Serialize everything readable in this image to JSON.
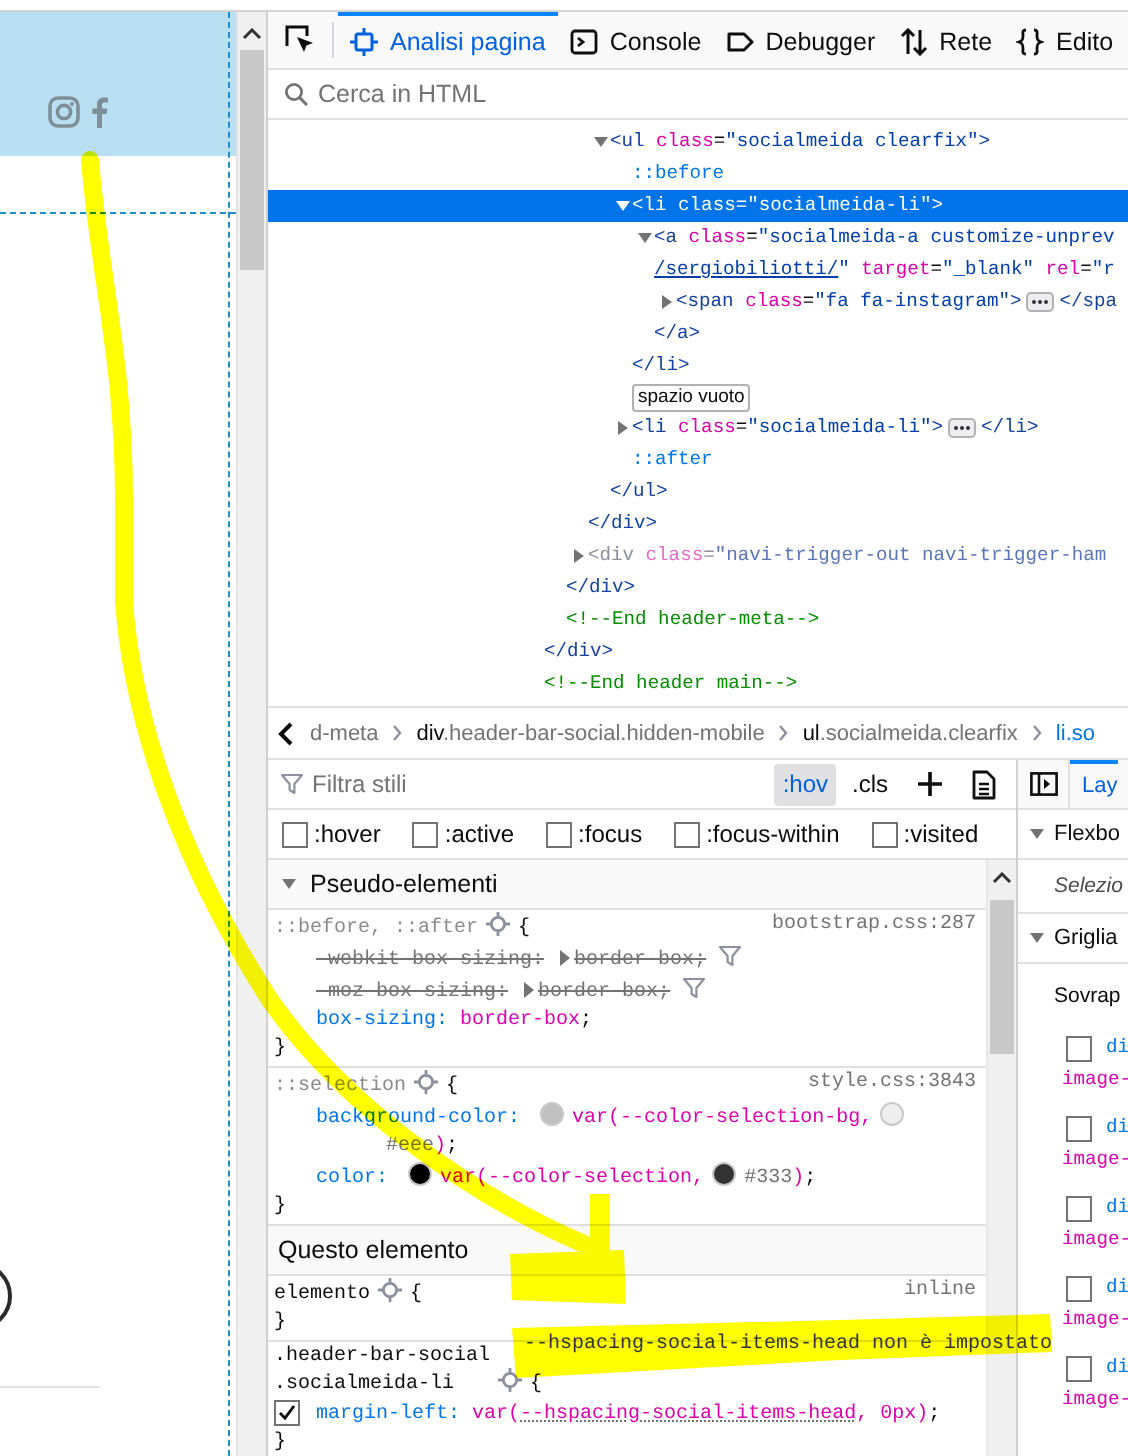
{
  "toolbar": {
    "tabs": [
      {
        "label": "Analisi pagina",
        "kind": "inspector",
        "selected": true
      },
      {
        "label": "Console",
        "kind": "console",
        "selected": false
      },
      {
        "label": "Debugger",
        "kind": "debugger",
        "selected": false
      },
      {
        "label": "Rete",
        "kind": "network",
        "selected": false
      },
      {
        "label": "Edito",
        "kind": "editor",
        "selected": false
      }
    ]
  },
  "html_search": {
    "placeholder": "Cerca in HTML"
  },
  "markup_tree": [
    {
      "children": [
        {
          "children": [
            {
              "children": [
                {
                  "kind": "tag",
                  "text": "<ul class=\"socialmeida clearfix\">",
                  "expanded": true,
                  "selected": false,
                  "children": [
                    {
                      "kind": "pseudo",
                      "text": "::before",
                      "selected": false
                    },
                    {
                      "kind": "tag",
                      "text": "<li class=\"socialmeida-li\">",
                      "expanded": true,
                      "selected": true,
                      "children": [
                        {
                          "kind": "tag",
                          "text": "<a class=\"socialmeida-a customize-unprev",
                          "wrap_link": "/sergiobiliotti/",
                          "wrap": "\" target=\"_blank\" rel=\"r",
                          "expanded": true,
                          "selected": false,
                          "children": [
                            {
                              "kind": "tag",
                              "text": "<span class=\"fa fa-instagram\">",
                              "end": "</spa",
                              "expanded": false,
                              "selected": false
                            }
                          ]
                        },
                        {
                          "kind": "tag",
                          "text": "</a>",
                          "selected": false
                        }
                      ]
                    },
                    {
                      "kind": "tag",
                      "text": "</li>",
                      "selected": false
                    },
                    {
                      "kind": "whitespace",
                      "text": "spazio vuoto",
                      "selected": false
                    },
                    {
                      "kind": "tag",
                      "text": "<li class=\"socialmeida-li\">",
                      "end": "</li>",
                      "expanded": false,
                      "selected": false
                    },
                    {
                      "kind": "pseudo",
                      "text": "::after",
                      "selected": false
                    }
                  ]
                },
                {
                  "kind": "tag",
                  "text": "</ul>",
                  "selected": false
                }
              ]
            },
            {
              "kind": "tag",
              "text": "</div>",
              "selected": false
            },
            {
              "kind": "tag",
              "text": "<div class=\"navi-trigger-out navi-trigger-ham",
              "expanded": false,
              "hidden_element": true,
              "selected": false
            }
          ]
        },
        {
          "kind": "tag",
          "text": "</div>",
          "selected": false
        },
        {
          "kind": "comment",
          "text": "<!--End header-meta-->",
          "selected": false
        }
      ]
    },
    {
      "kind": "tag",
      "text": "</div>",
      "selected": false
    },
    {
      "kind": "comment",
      "text": "<!--End header main-->",
      "selected": false
    }
  ],
  "breadcrumbs": [
    {
      "text": "d-meta",
      "selected": false
    },
    {
      "text": "div.header-bar-social.hidden-mobile",
      "selected": false
    },
    {
      "text": "ul.socialmeida.clearfix",
      "selected": false
    },
    {
      "text": "li.so",
      "selected": true
    }
  ],
  "rules_toolbar": {
    "filter_placeholder": "Filtra stili",
    "toggles": [
      {
        "label": ":hov",
        "pressed": true
      },
      {
        "label": ".cls",
        "pressed": false
      }
    ]
  },
  "pseudo_classes": [
    {
      "label": ":hover",
      "checked": false
    },
    {
      "label": ":active",
      "checked": false
    },
    {
      "label": ":focus",
      "checked": false
    },
    {
      "label": ":focus-within",
      "checked": false
    },
    {
      "label": ":visited",
      "checked": false
    }
  ],
  "styles": [
    {
      "kind": "section",
      "title": "Pseudo-elementi",
      "expanded": true
    },
    {
      "kind": "rule",
      "selector": [
        "::before, ::after"
      ],
      "matched": false,
      "source": "bootstrap.css:287",
      "brace_open": "{",
      "brace_close": "}",
      "declarations": [
        {
          "property": "-webkit-box-sizing:",
          "value": [
            {
              "kind": "keyword",
              "text": "border-box"
            },
            {
              "kind": "punct",
              "text": ";"
            }
          ],
          "overridden": true,
          "enabled": true,
          "hovered": false
        },
        {
          "property": "-moz-box-sizing:",
          "value": [
            {
              "kind": "keyword",
              "text": "border-box"
            },
            {
              "kind": "punct",
              "text": ";"
            }
          ],
          "overridden": true,
          "enabled": true,
          "hovered": false
        },
        {
          "property": "box-sizing:",
          "value": [
            {
              "kind": "keyword",
              "text": "border-box"
            },
            {
              "kind": "punct",
              "text": ";"
            }
          ],
          "overridden": false,
          "enabled": true,
          "hovered": false
        }
      ]
    },
    {
      "kind": "rule",
      "selector": [
        "::selection"
      ],
      "matched": false,
      "source": "style.css:3843",
      "brace_open": "{",
      "brace_close": "}",
      "declarations": [
        {
          "property": "background-color:",
          "value": [
            {
              "kind": "swatch",
              "color": "#c0c0c0"
            },
            {
              "kind": "keyword",
              "text": "var(--color-selection-bg,"
            },
            {
              "kind": "swatch",
              "color": "#eeeeee"
            },
            {
              "kind": "fallback",
              "text": "#eee"
            },
            {
              "kind": "keyword",
              "text": ")"
            },
            {
              "kind": "punct",
              "text": ";"
            }
          ],
          "overridden": false,
          "enabled": true,
          "hovered": false
        },
        {
          "property": "color:",
          "value": [
            {
              "kind": "swatch",
              "color": "#000000"
            },
            {
              "kind": "keyword",
              "text": "var(--color-selection,"
            },
            {
              "kind": "swatch",
              "color": "#333333"
            },
            {
              "kind": "fallback",
              "text": "#333"
            },
            {
              "kind": "keyword",
              "text": ")"
            },
            {
              "kind": "punct",
              "text": ";"
            }
          ],
          "overridden": false,
          "enabled": true,
          "hovered": false
        }
      ]
    },
    {
      "kind": "heading",
      "title": "Questo elemento"
    },
    {
      "kind": "rule",
      "selector": [
        "elemento"
      ],
      "matched": true,
      "source": "inline",
      "brace_open": "{",
      "brace_close": "}"
    },
    {
      "kind": "rule",
      "selector": [
        ".header-bar-social",
        ".socialmeida-li"
      ],
      "matched": true,
      "brace_open": "{",
      "brace_close": "}",
      "declarations": [
        {
          "property": "margin-left:",
          "value": [
            {
              "kind": "keyword",
              "text": "var("
            },
            {
              "kind": "unset_variable",
              "text": "--hspacing-social-items-head"
            },
            {
              "kind": "keyword",
              "text": ", 0px)"
            },
            {
              "kind": "punct",
              "text": ";"
            }
          ],
          "overridden": false,
          "enabled": true,
          "hovered": true
        }
      ]
    }
  ],
  "tooltip": {
    "text": "--hspacing-social-items-head non è impostato"
  },
  "layout_pane": {
    "tabs": [
      {
        "label": "Lay",
        "selected": true
      }
    ],
    "flexbox": {
      "title": "Flexbo",
      "expanded": true,
      "message": "Selezio"
    },
    "grid": {
      "title": "Griglia",
      "expanded": true,
      "subtitle": "Sovrap",
      "overlays": [
        {
          "element": "di",
          "detail": "image-",
          "checked": false
        },
        {
          "element": "di",
          "detail": "image-",
          "checked": false
        },
        {
          "element": "di",
          "detail": "image-",
          "checked": false
        },
        {
          "element": "di",
          "detail": "image-",
          "checked": false
        },
        {
          "element": "di",
          "detail": "image-",
          "checked": false
        }
      ]
    }
  }
}
